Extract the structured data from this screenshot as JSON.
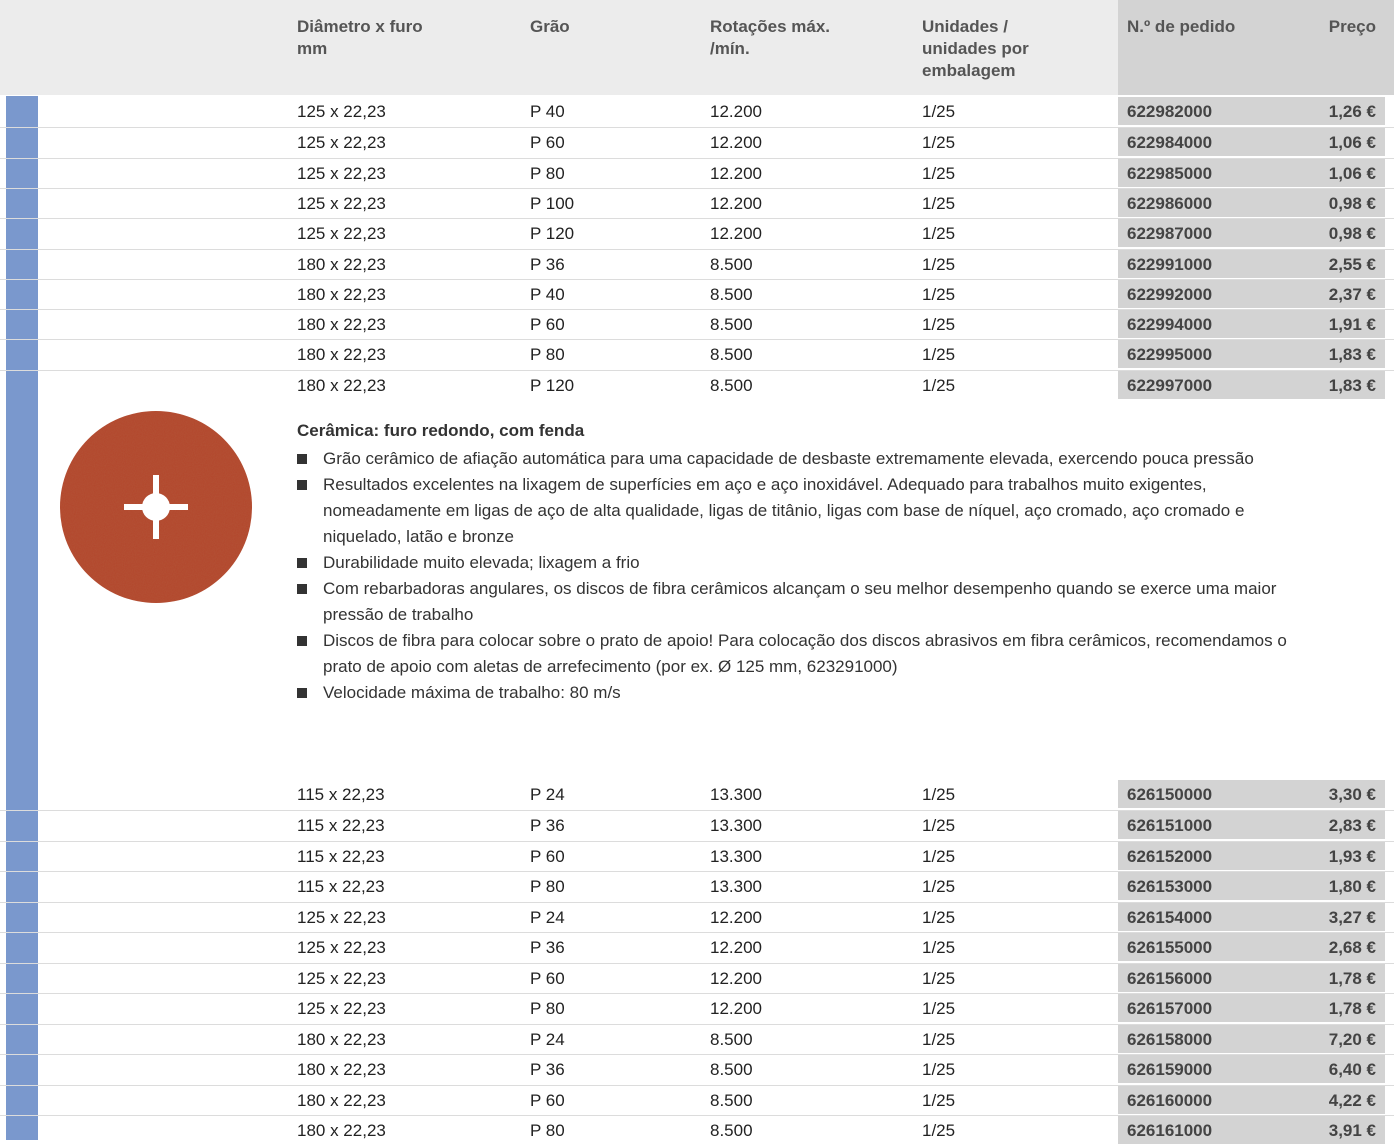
{
  "header": {
    "col_diameter": "Diâmetro x furo\nmm",
    "col_grain": "Grão",
    "col_rpm": "Rotações máx.\n/mín.",
    "col_units": "Unidades /\nunidades por\nembalagem",
    "col_order": "N.º de pedido",
    "col_price": "Preço"
  },
  "colors": {
    "sidebar": "#7a98cd",
    "header_bg": "#ececec",
    "gray_cells": "#d3d3d3",
    "disc": "#b3452a"
  },
  "table1": [
    [
      "125 x 22,23",
      "P 40",
      "12.200",
      "1/25",
      "622982000",
      "1,26 €"
    ],
    [
      "125 x 22,23",
      "P 60",
      "12.200",
      "1/25",
      "622984000",
      "1,06 €"
    ],
    [
      "125 x 22,23",
      "P 80",
      "12.200",
      "1/25",
      "622985000",
      "1,06 €"
    ],
    [
      "125 x 22,23",
      "P 100",
      "12.200",
      "1/25",
      "622986000",
      "0,98 €"
    ],
    [
      "125 x 22,23",
      "P 120",
      "12.200",
      "1/25",
      "622987000",
      "0,98 €"
    ],
    [
      "180 x 22,23",
      "P 36",
      "8.500",
      "1/25",
      "622991000",
      "2,55 €"
    ],
    [
      "180 x 22,23",
      "P 40",
      "8.500",
      "1/25",
      "622992000",
      "2,37 €"
    ],
    [
      "180 x 22,23",
      "P 60",
      "8.500",
      "1/25",
      "622994000",
      "1,91 €"
    ],
    [
      "180 x 22,23",
      "P 80",
      "8.500",
      "1/25",
      "622995000",
      "1,83 €"
    ],
    [
      "180 x 22,23",
      "P 120",
      "8.500",
      "1/25",
      "622997000",
      "1,83 €"
    ]
  ],
  "description": {
    "title": "Cerâmica: furo redondo, com fenda",
    "bullets": [
      "Grão cerâmico de afiação automática para uma capacidade de desbaste extremamente elevada, exercendo pouca pressão",
      "Resultados excelentes na lixagem de superfícies em aço e aço inoxidável. Adequado para trabalhos muito exigentes, nomeadamente em ligas de aço de alta qualidade, ligas de titânio, ligas com base de níquel, aço cromado, aço cromado e niquelado, latão e bronze",
      "Durabilidade muito elevada; lixagem a frio",
      "Com rebarbadoras angulares, os discos de fibra cerâmicos alcançam o seu melhor desempenho quando se exerce uma maior pressão de trabalho",
      "Discos de fibra para colocar sobre o prato de apoio! Para colocação dos discos abrasivos em fibra cerâmicos, recomendamos o prato de apoio com aletas de arrefecimento (por ex. Ø 125 mm, 623291000)",
      "Velocidade máxima de trabalho: 80 m/s"
    ]
  },
  "table2": [
    [
      "115 x 22,23",
      "P 24",
      "13.300",
      "1/25",
      "626150000",
      "3,30 €"
    ],
    [
      "115 x 22,23",
      "P 36",
      "13.300",
      "1/25",
      "626151000",
      "2,83 €"
    ],
    [
      "115 x 22,23",
      "P 60",
      "13.300",
      "1/25",
      "626152000",
      "1,93 €"
    ],
    [
      "115 x 22,23",
      "P 80",
      "13.300",
      "1/25",
      "626153000",
      "1,80 €"
    ],
    [
      "125 x 22,23",
      "P 24",
      "12.200",
      "1/25",
      "626154000",
      "3,27 €"
    ],
    [
      "125 x 22,23",
      "P 36",
      "12.200",
      "1/25",
      "626155000",
      "2,68 €"
    ],
    [
      "125 x 22,23",
      "P 60",
      "12.200",
      "1/25",
      "626156000",
      "1,78 €"
    ],
    [
      "125 x 22,23",
      "P 80",
      "12.200",
      "1/25",
      "626157000",
      "1,78 €"
    ],
    [
      "180 x 22,23",
      "P 24",
      "8.500",
      "1/25",
      "626158000",
      "7,20 €"
    ],
    [
      "180 x 22,23",
      "P 36",
      "8.500",
      "1/25",
      "626159000",
      "6,40 €"
    ],
    [
      "180 x 22,23",
      "P 60",
      "8.500",
      "1/25",
      "626160000",
      "4,22 €"
    ],
    [
      "180 x 22,23",
      "P 80",
      "8.500",
      "1/25",
      "626161000",
      "3,91 €"
    ]
  ]
}
